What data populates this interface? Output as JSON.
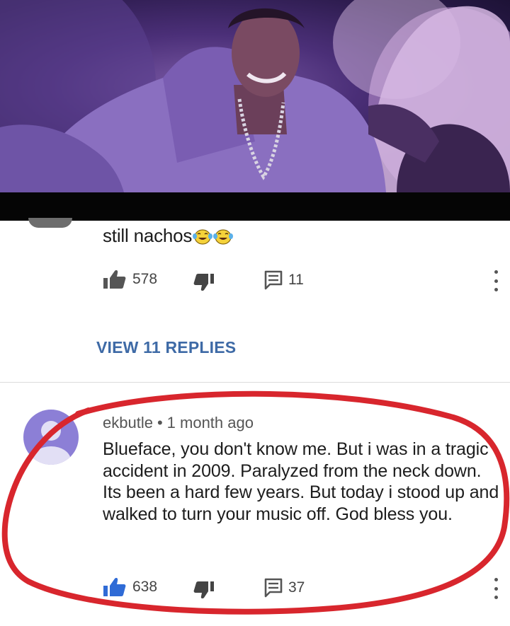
{
  "comment1": {
    "text": "still nachos",
    "emoji": [
      "face-with-tears-of-joy",
      "face-with-tears-of-joy"
    ],
    "likes": "578",
    "replies_count": "11",
    "view_replies_label": "VIEW 11 REPLIES"
  },
  "comment2": {
    "author": "ekbutle",
    "separator": "•",
    "time": "1 month ago",
    "body": "Blueface, you don't know me. But i was in a tragic accident in 2009. Paralyzed from the neck down. Its been a hard few years. But today i stood up and walked to turn your music off. God bless you.",
    "likes": "638",
    "replies_count": "37"
  },
  "colors": {
    "link_blue": "#3e6aa6",
    "like_active": "#2f6bd6",
    "highlight_circle": "#d8262d",
    "avatar": "#8c7fd6"
  },
  "icons": {
    "like": "thumbs-up-icon",
    "dislike": "thumbs-down-icon",
    "reply": "comment-icon",
    "more": "more-vertical-icon"
  }
}
